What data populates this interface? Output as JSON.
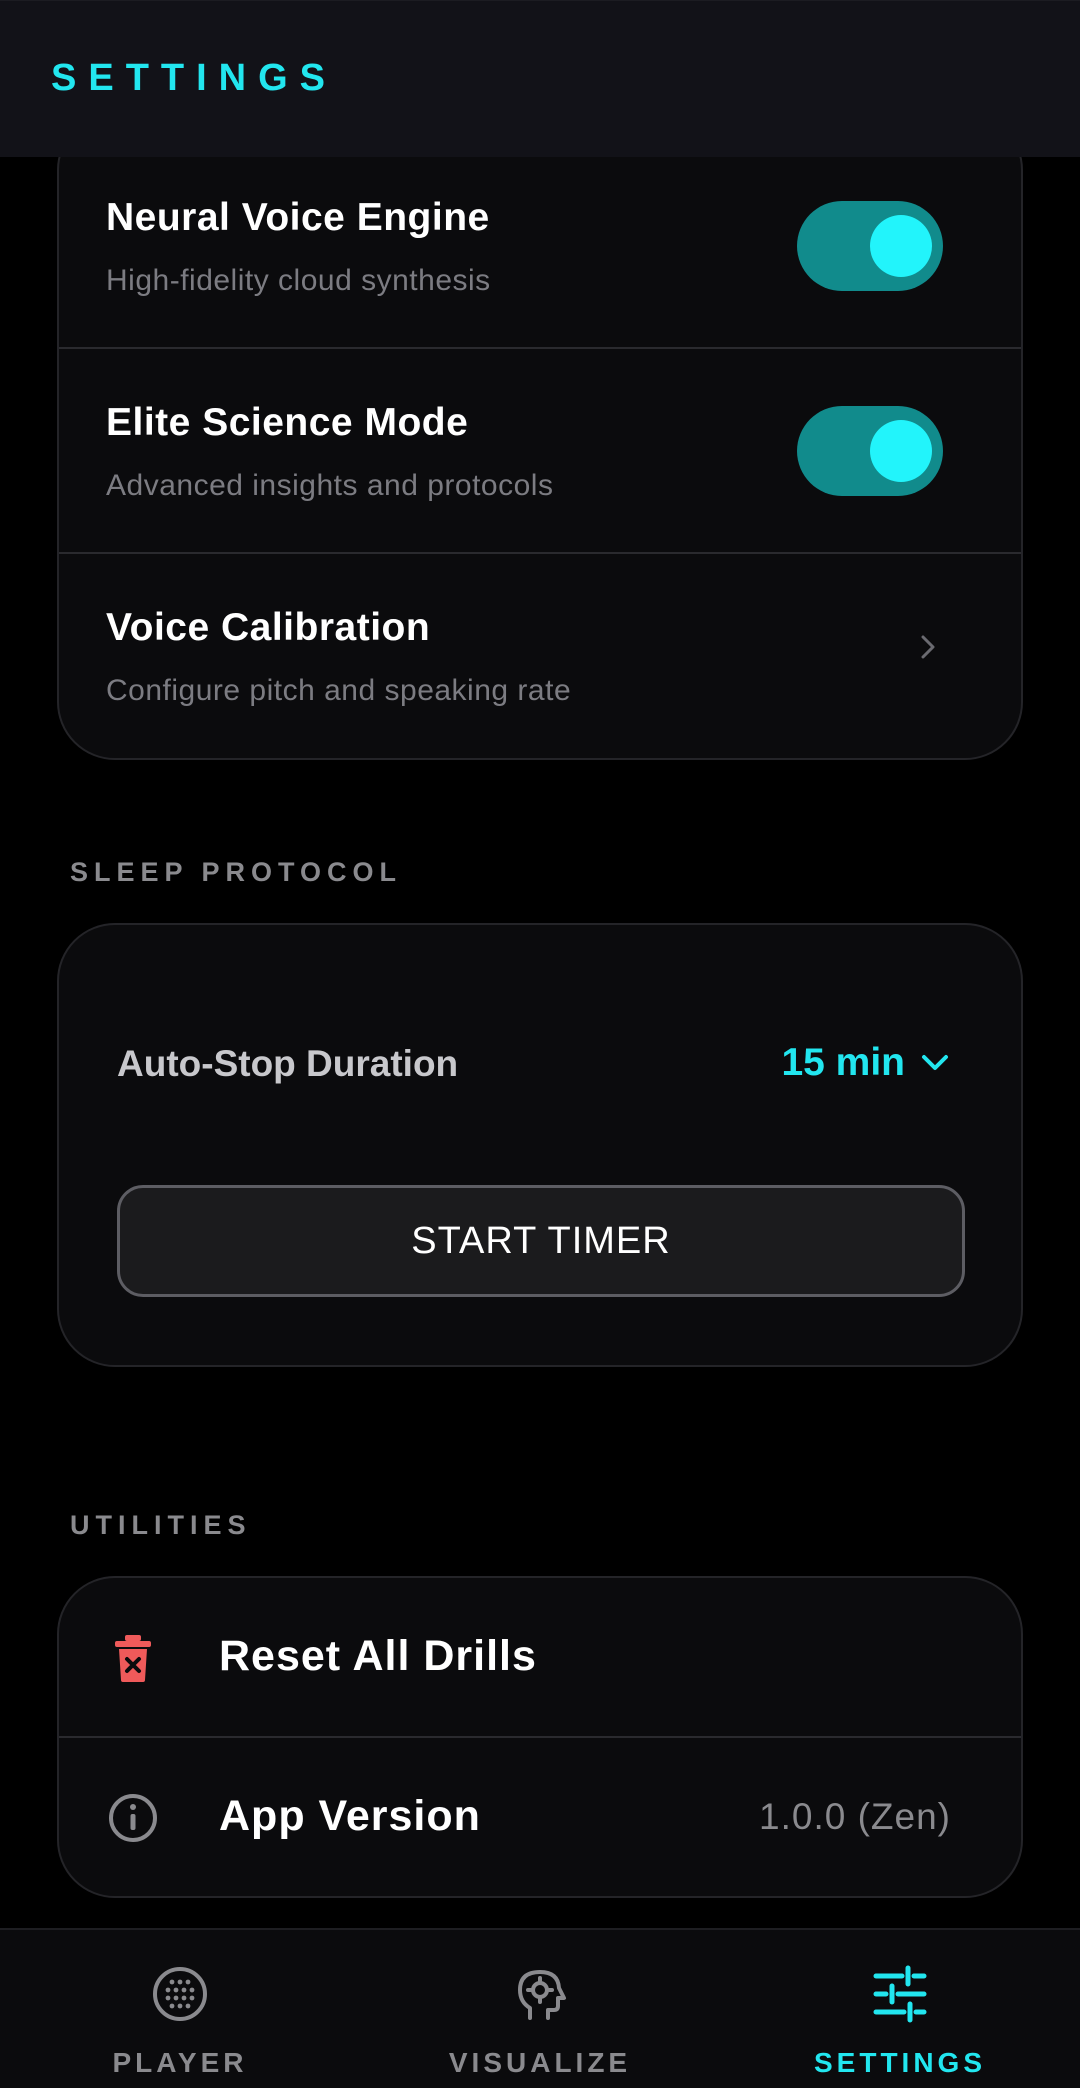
{
  "header": {
    "title": "SETTINGS"
  },
  "voice_card": {
    "items": [
      {
        "title": "Neural Voice Engine",
        "subtitle": "High-fidelity cloud synthesis",
        "toggle": true
      },
      {
        "title": "Elite Science Mode",
        "subtitle": "Advanced insights and protocols",
        "toggle": true
      },
      {
        "title": "Voice Calibration",
        "subtitle": "Configure pitch and speaking rate",
        "icon": "chevron-right-icon"
      }
    ]
  },
  "sleep_protocol": {
    "section_label": "SLEEP PROTOCOL",
    "auto_stop_label": "Auto-Stop Duration",
    "duration_value": "15 min",
    "start_button": "START TIMER"
  },
  "utilities": {
    "section_label": "UTILITIES",
    "reset_label": "Reset All Drills",
    "reset_icon": "trash-icon",
    "version_label": "App Version",
    "version_icon": "info-icon",
    "version_value": "1.0.0 (Zen)"
  },
  "nav": {
    "items": [
      {
        "label": "PLAYER",
        "icon": "sphere-grid-icon",
        "active": false
      },
      {
        "label": "VISUALIZE",
        "icon": "head-gear-icon",
        "active": false
      },
      {
        "label": "SETTINGS",
        "icon": "sliders-icon",
        "active": true
      }
    ]
  },
  "colors": {
    "accent": "#22e6ef",
    "toggle_track": "#118b8c",
    "danger": "#ef5a5a",
    "muted": "#8a8a8e"
  }
}
